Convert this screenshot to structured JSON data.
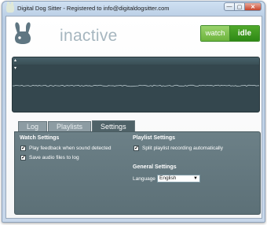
{
  "window": {
    "title": "Digital Dog Sitter - Registered to info@digitaldogsitter.com",
    "controls": {
      "minimize": "—",
      "restore": "▢",
      "close": "✕"
    }
  },
  "header": {
    "status": "inactive",
    "mode_toggle": {
      "watch_label": "watch",
      "idle_label": "idle",
      "active": "idle"
    }
  },
  "waveform": {
    "top_marker": "▴",
    "level_marker": "▾"
  },
  "tabs": [
    {
      "label": "Log",
      "active": false
    },
    {
      "label": "Playlists",
      "active": false
    },
    {
      "label": "Settings",
      "active": true
    }
  ],
  "settings": {
    "watch": {
      "title": "Watch Settings",
      "options": [
        {
          "label": "Play feedback when sound detected",
          "checked": true
        },
        {
          "label": "Save audio files to log",
          "checked": true
        }
      ]
    },
    "playlist": {
      "title": "Playlist Settings",
      "options": [
        {
          "label": "Split playlist recording automatically",
          "checked": true
        }
      ]
    },
    "general": {
      "title": "General Settings",
      "language_label": "Language",
      "language_value": "English"
    }
  },
  "colors": {
    "accent_green": "#2e8915",
    "panel": "#5c7077",
    "waveform_bg": "#34474e",
    "status_text": "#a6b6bf"
  },
  "icons": {
    "app": "rabbit-ear-icon",
    "logo": "rabbit-ear-logo",
    "check": "✓",
    "dropdown": "▼"
  }
}
